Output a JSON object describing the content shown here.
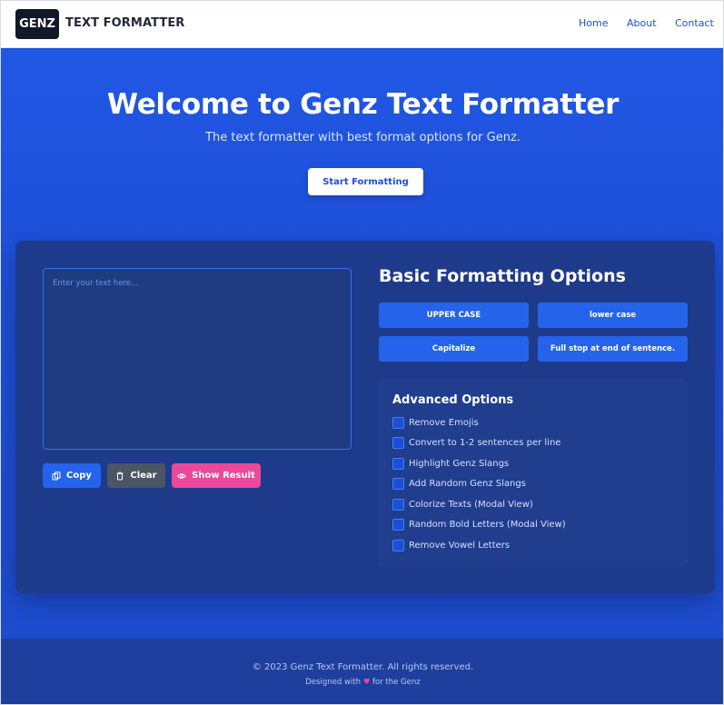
{
  "header": {
    "logo_text": "GENZ",
    "brand_name": "TEXT FORMATTER",
    "nav": [
      "Home",
      "About",
      "Contact"
    ]
  },
  "hero": {
    "title": "Welcome to Genz Text Formatter",
    "subtitle": "The text formatter with best format options for Genz.",
    "cta_label": "Start Formatting"
  },
  "editor": {
    "placeholder": "Enter your text here...",
    "copy_label": "Copy",
    "clear_label": "Clear",
    "show_result_label": "Show Result"
  },
  "basic": {
    "title": "Basic Formatting Options",
    "buttons": [
      "UPPER CASE",
      "lower case",
      "Capitalize",
      "Full stop at end of sentence."
    ]
  },
  "advanced": {
    "title": "Advanced Options",
    "options": [
      "Remove Emojis",
      "Convert to 1-2 sentences per line",
      "Highlight Genz Slangs",
      "Add Random Genz Slangs",
      "Colorize Texts (Modal View)",
      "Random Bold Letters (Modal View)",
      "Remove Vowel Letters"
    ]
  },
  "footer": {
    "copyright": "© 2023 Genz Text Formatter. All rights reserved.",
    "designed_prefix": "Designed with",
    "heart": "♥",
    "designed_suffix": "for the Genz"
  },
  "colors": {
    "accent": "#2563eb",
    "hero_bg": "#1f4ed8",
    "panel_bg": "#1e3a8a",
    "copy": "#2563eb",
    "clear": "#4b5563",
    "show_result": "#ec4899"
  },
  "icons": {
    "copy": "copy-icon",
    "clear": "trash-icon",
    "show_result": "eye-icon"
  }
}
